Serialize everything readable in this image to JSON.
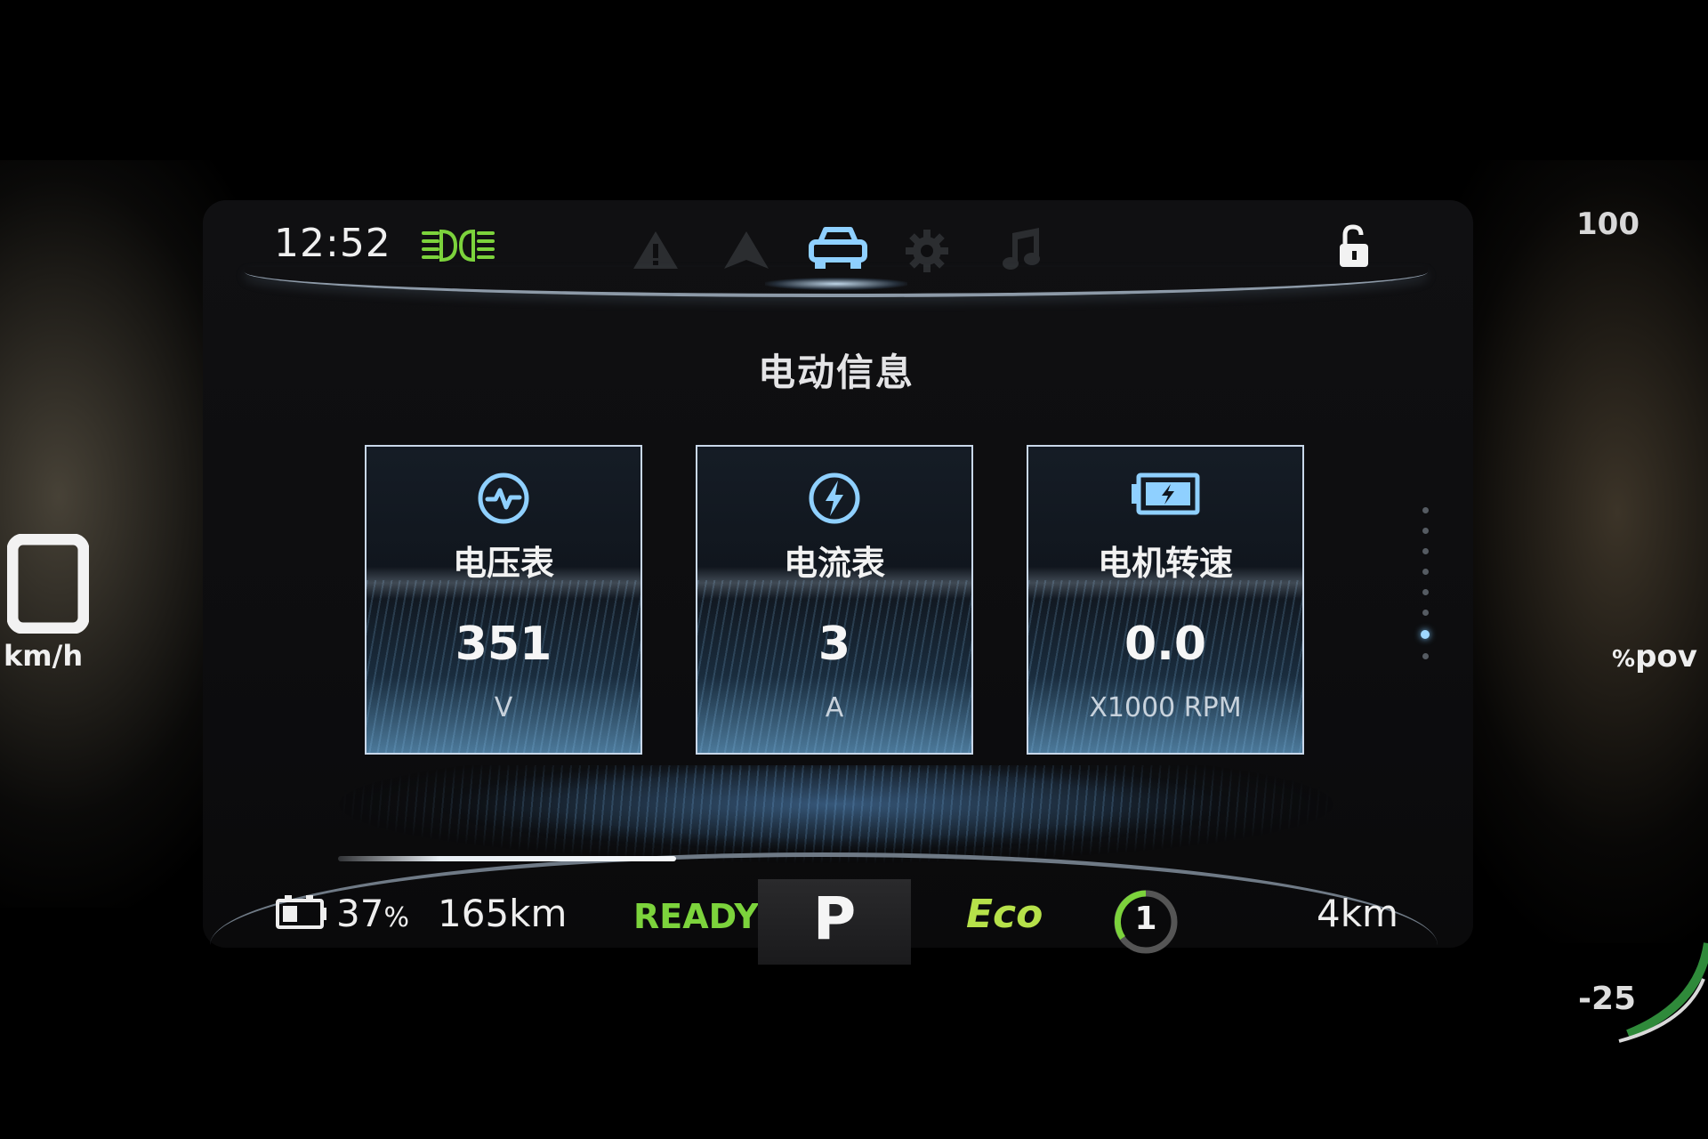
{
  "colors": {
    "accent_green": "#7cd33c",
    "eco_green": "#b6e14a",
    "card_glow_blue": "#6eb4e6",
    "seatbelt_red": "#e4262a",
    "active_icon_blue": "#8fd0ff"
  },
  "status_bar": {
    "time": "12:52",
    "icons": [
      "headlight-icon",
      "warning-icon",
      "navigation-icon",
      "car-icon",
      "settings-icon",
      "music-icon",
      "unlock-icon"
    ],
    "active_tab": "car-icon"
  },
  "screen": {
    "title": "电动信息"
  },
  "cards": [
    {
      "icon": "pulse-icon",
      "label": "电压表",
      "value": "351",
      "unit": "V"
    },
    {
      "icon": "bolt-icon",
      "label": "电流表",
      "value": "3",
      "unit": "A"
    },
    {
      "icon": "motor-battery-icon",
      "label": "电机转速",
      "value": "0.0",
      "unit": "X1000 RPM"
    }
  ],
  "pager": {
    "page_count": 8,
    "active_page": 7
  },
  "speedometer": {
    "value": "0",
    "unit": "km/h"
  },
  "power_gauge": {
    "max_label": "100",
    "min_label": "-25",
    "label_prefix": "%",
    "label_text": "pov"
  },
  "bottom_bar": {
    "battery_percent": "37",
    "percent_sign": "%",
    "range": "165km",
    "ready": "READY",
    "gear": "P",
    "drive_mode": "Eco",
    "regen_level": "1",
    "trip": "4km",
    "battery_level": 0.37
  }
}
